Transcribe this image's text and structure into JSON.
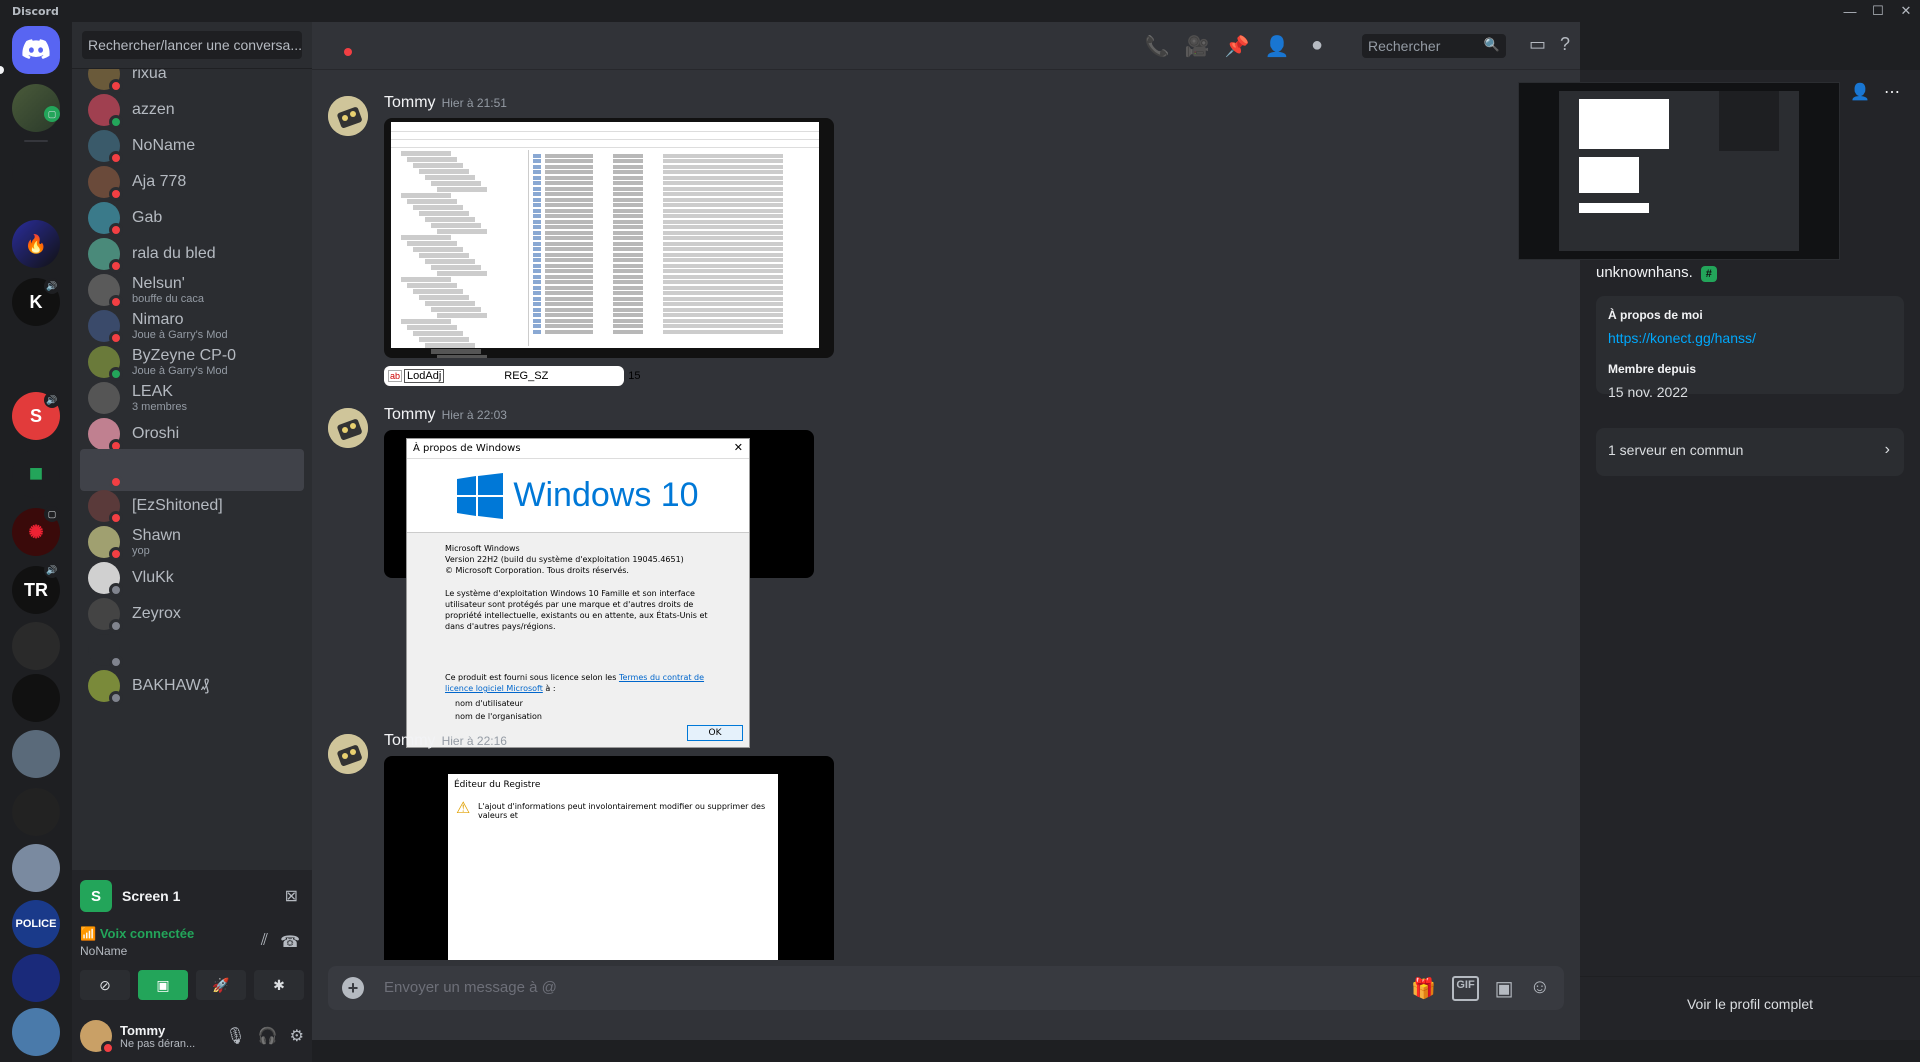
{
  "window": {
    "title": "Discord",
    "controls": [
      "—",
      "☐",
      "✕"
    ]
  },
  "sidebar": {
    "search_placeholder": "Rechercher/lancer une conversa...",
    "dms": [
      {
        "name": "rixua",
        "sub": "",
        "status": "dnd"
      },
      {
        "name": "azzen",
        "sub": "",
        "status": "on"
      },
      {
        "name": "NoName",
        "sub": "",
        "status": "dnd"
      },
      {
        "name": "Aja 778",
        "sub": "",
        "status": "dnd"
      },
      {
        "name": "Gab",
        "sub": "",
        "status": "dnd"
      },
      {
        "name": "rala du bled",
        "sub": "",
        "status": "dnd"
      },
      {
        "name": "Nelsun'",
        "sub": "bouffe du caca",
        "status": "dnd"
      },
      {
        "name": "Nimaro",
        "sub": "Joue à Garry's Mod",
        "status": "dnd"
      },
      {
        "name": "ByZeyne CP-0",
        "sub": "Joue à Garry's Mod",
        "status": "on"
      },
      {
        "name": "LEAK",
        "sub": "3 membres",
        "status": ""
      },
      {
        "name": "Oroshi",
        "sub": "",
        "status": "dnd"
      },
      {
        "name": "",
        "sub": "",
        "status": "dnd"
      },
      {
        "name": "[EzShitoned]",
        "sub": "",
        "status": "dnd"
      },
      {
        "name": "Shawn",
        "sub": "yop",
        "status": "dnd"
      },
      {
        "name": "VluKk",
        "sub": "",
        "status": "off"
      },
      {
        "name": "Zeyrox",
        "sub": "",
        "status": "off"
      },
      {
        "name": "",
        "sub": "",
        "status": "off"
      },
      {
        "name": "BAKHAW₰",
        "sub": "",
        "status": "off"
      }
    ],
    "voice": {
      "screen_label": "Screen 1",
      "screen_icon_letter": "S",
      "connected_label": "Voix connectée",
      "channel": "NoName"
    },
    "user": {
      "name": "Tommy",
      "status": "Ne pas déran..."
    }
  },
  "header": {
    "search_placeholder": "Rechercher"
  },
  "messages": [
    {
      "author": "Tommy",
      "time": "Hier à 21:51"
    },
    {
      "author": "Tommy",
      "time": "Hier à 22:03"
    },
    {
      "author": "Tommy",
      "time": "Hier à 22:16"
    }
  ],
  "registry_strip": {
    "name": "LodAdj",
    "type": "REG_SZ",
    "value": "15",
    "icon_text": "ab"
  },
  "about_windows": {
    "title": "À propos de Windows",
    "product": "Windows 10",
    "line1": "Microsoft Windows",
    "line2": "Version 22H2 (build du système d'exploitation 19045.4651)",
    "line3": "© Microsoft Corporation. Tous droits réservés.",
    "para": "Le système d'exploitation Windows 10 Famille et son interface utilisateur sont protégés par une marque et d'autres droits de propriété intellectuelle, existants ou en attente, aux États-Unis et dans d'autres pays/régions.",
    "license_prefix": "Ce produit est fourni sous licence selon les ",
    "license_link": "Termes du contrat de licence logiciel Microsoft",
    "license_suffix": " à :",
    "user_line": "nom d'utilisateur",
    "org_line": "nom de l'organisation",
    "ok": "OK"
  },
  "registry_dialog": {
    "title": "Éditeur du Registre",
    "text": "L'ajout d'informations peut involontairement modifier ou supprimer des valeurs et"
  },
  "composer": {
    "placeholder": "Envoyer un message à @"
  },
  "profile": {
    "username": "unknownhans.",
    "about_title": "À propos de moi",
    "about_link": "https://konect.gg/hanss/",
    "member_title": "Membre depuis",
    "member_since": "15 nov. 2022",
    "mutual": "1 serveur en commun",
    "view_full": "Voir le profil complet"
  },
  "colors": {
    "accent": "#5865f2",
    "green": "#23a55a",
    "dnd": "#f23f43",
    "link": "#00a8fc"
  }
}
